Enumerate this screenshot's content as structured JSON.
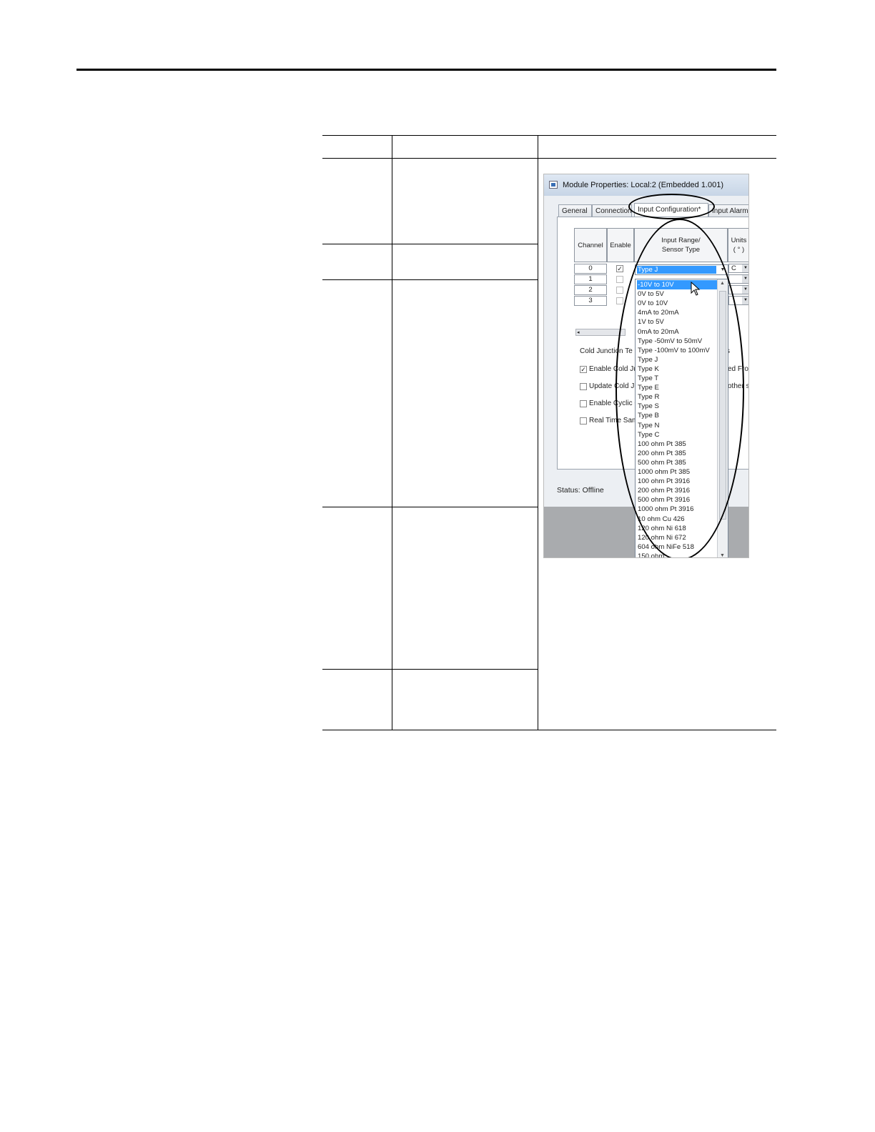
{
  "dialog": {
    "title": "Module Properties: Local:2 (Embedded 1.001)",
    "tabs": [
      "General",
      "Connection",
      "Input Configuration*",
      "Input Alarms"
    ],
    "grid": {
      "headers": {
        "channel": "Channel",
        "enable": "Enable",
        "input_range": "Input Range/\nSensor Type",
        "units": "Units\n( ° )"
      },
      "rows": [
        {
          "channel": "0",
          "enabled": "✓",
          "units": "C"
        },
        {
          "channel": "1",
          "enabled": "",
          "units": ""
        },
        {
          "channel": "2",
          "enabled": "",
          "units": ""
        },
        {
          "channel": "3",
          "enabled": "",
          "units": ""
        }
      ],
      "combo_value": "Type J"
    },
    "options": [
      {
        "label": "Cold Junction Te",
        "right": "s"
      },
      {
        "label": "Enable Cold Ju",
        "right": "ed Fro",
        "checked": "✓"
      },
      {
        "label": "Update Cold J",
        "right": "other s",
        "checked": ""
      },
      {
        "label": "Enable Cyclic C",
        "right": "",
        "checked": ""
      },
      {
        "label": "Real Time Sam",
        "right": "",
        "checked": ""
      }
    ],
    "status_label": "Status:",
    "status_value": "Offline",
    "dropdown_items": [
      "-10V to 10V",
      "0V to 5V",
      "0V to 10V",
      "4mA to 20mA",
      "1V to 5V",
      "0mA to 20mA",
      "Type -50mV to 50mV",
      "Type -100mV to 100mV",
      "Type J",
      "Type K",
      "Type T",
      "Type E",
      "Type R",
      "Type S",
      "Type B",
      "Type N",
      "Type C",
      "100 ohm Pt 385",
      "200 ohm Pt 385",
      "500 ohm Pt 385",
      "1000 ohm Pt 385",
      "100 ohm Pt 3916",
      "200 ohm Pt 3916",
      "500 ohm Pt 3916",
      "1000 ohm Pt 3916",
      "10 ohm Cu 426",
      "120 ohm Ni 618",
      "120 ohm Ni 672",
      "604 ohm NiFe 518",
      "150 ohm"
    ],
    "selected_index": 0
  }
}
